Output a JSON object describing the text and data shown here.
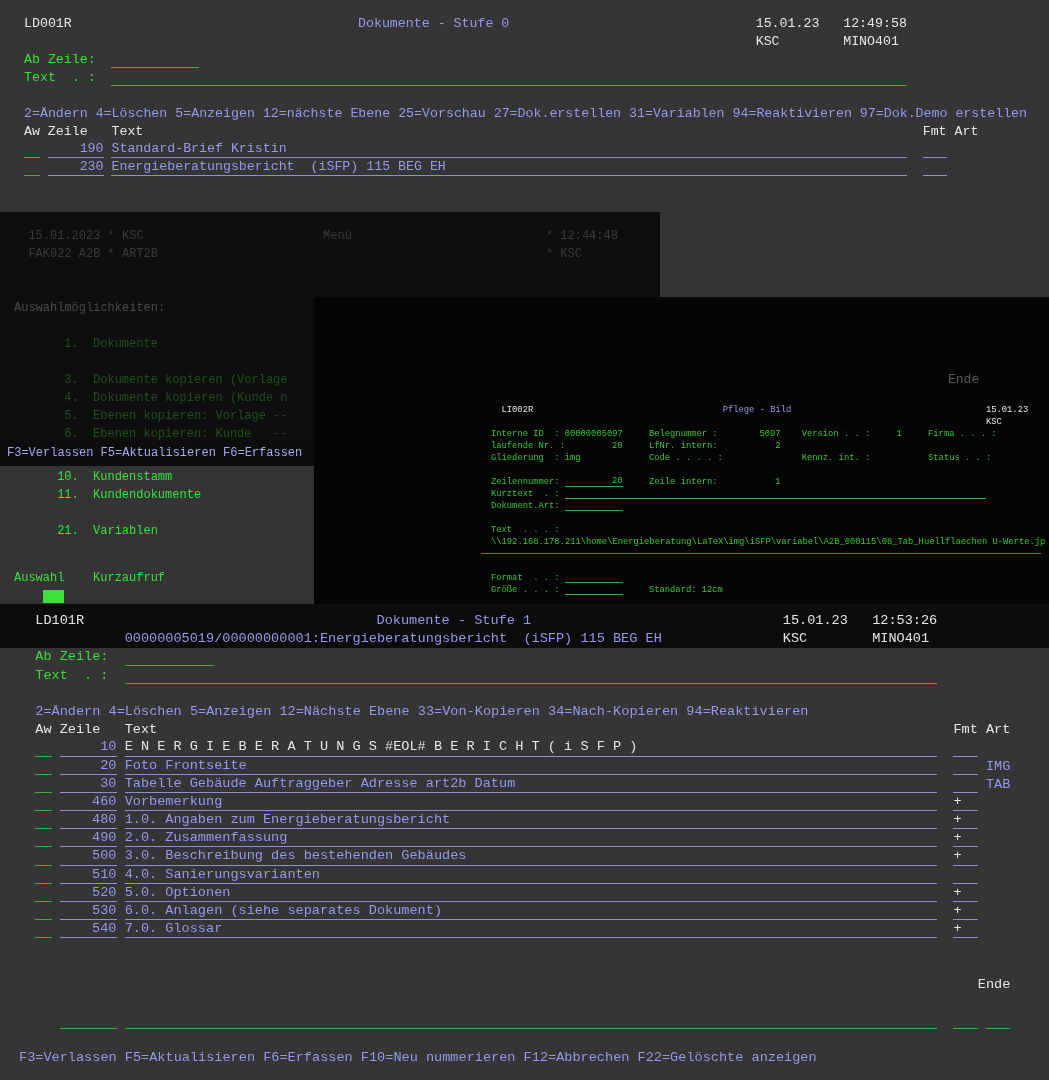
{
  "top_screen": {
    "program": "LD001R",
    "title": "Dokumente - Stufe 0",
    "date": "15.01.23",
    "time": "12:49:58",
    "user": "KSC",
    "device": "MINO401",
    "filters": [
      {
        "label": "Ab Zeile:"
      },
      {
        "label": "Text  . :"
      }
    ],
    "options": "2=Ändern 4=Löschen 5=Anzeigen 12=nächste Ebene 25=Vorschau 27=Dok.erstellen 31=Variablen 94=Reaktivieren 97=Dok.Demo erstellen",
    "columns": [
      "Aw",
      "Zeile",
      "Text",
      "Fmt",
      "Art"
    ],
    "rows": [
      {
        "line": "190",
        "text": "Standard-Brief Kristin"
      },
      {
        "line": "230",
        "text": "Energieberatungsbericht  (iSFP) 115 BEG EH"
      }
    ]
  },
  "menu_screen": {
    "date_user": "15.01.2023 * KSC",
    "title": "Menü",
    "time": "* 12:44:48",
    "session": "FAK022 A2B * ART2B",
    "user": "* KSC",
    "heading": "Auswahlmöglichkeiten:",
    "item_groups": [
      {
        "dimmed": true,
        "items": [
          {
            "number": "1.",
            "label": "Dokumente"
          }
        ]
      },
      {
        "dimmed": true,
        "items": [
          {
            "number": "3.",
            "label": "Dokumente kopieren (Vorlage"
          },
          {
            "number": "4.",
            "label": "Dokumente kopieren (Kunde n"
          },
          {
            "number": "5.",
            "label": "Ebenen kopieren: Vorlage --"
          },
          {
            "number": "6.",
            "label": "Ebenen kopieren: Kunde   --"
          }
        ]
      },
      {
        "dimmed": false,
        "items": [
          {
            "number": "10.",
            "label": "Kundenstamm"
          },
          {
            "number": "11.",
            "label": "Kundendokumente"
          }
        ]
      },
      {
        "dimmed": false,
        "items": [
          {
            "number": "21.",
            "label": "Variablen"
          }
        ]
      }
    ],
    "selection_label": "Auswahl",
    "shortcut_label": "Kurzaufruf"
  },
  "function_strip": {
    "keys": "F3=Verlassen F5=Aktualisieren F6=Erfassen"
  },
  "detail_window": {
    "end_label": "Ende",
    "program": "LI002R",
    "title": "Pflege - Bild",
    "date": "15.01.23",
    "user": "KSC",
    "sections": [
      [
        [
          {
            "label": "Interne ID  :",
            "value": "00000005097",
            "kind": "number"
          },
          {
            "label": "Belegnummer :",
            "value": "5097",
            "kind": "number"
          },
          {
            "label": "Version . . :",
            "value": "1",
            "kind": "number"
          },
          {
            "label": "Firma . . . :",
            "kind": "label"
          }
        ],
        [
          {
            "label": "laufende Nr. :",
            "value": "20",
            "kind": "number"
          },
          {
            "label": "LfNr. intern:",
            "value": "2",
            "kind": "number"
          }
        ],
        [
          {
            "label": "Gliederung  :",
            "value": "img",
            "kind": "text"
          },
          {
            "label": "Code . . . . :",
            "kind": "label"
          },
          {
            "label": "Kennz. int. :",
            "kind": "label"
          },
          {
            "label": "Status . . :",
            "kind": "label"
          }
        ]
      ],
      [
        [
          {
            "label": "Zeilennummer:",
            "value": "20",
            "kind": "field"
          },
          {
            "label": "Zeile intern:",
            "value": "1",
            "kind": "number"
          }
        ],
        [
          {
            "label": "Kurztext  . :",
            "kind": "long_field"
          }
        ],
        [
          {
            "label": "Dokument.Art:",
            "kind": "field"
          }
        ]
      ],
      [
        [
          {
            "label": "Text  . . . :",
            "kind": "label"
          }
        ],
        [
          {
            "value": "\\\\192.168.178.211\\home\\Energieberatung\\LaTeX\\img\\iSFP\\variabel\\A2B_000115\\08_Tab_Huellflaechen U-Werte.jp",
            "kind": "path"
          }
        ]
      ],
      [
        [
          {
            "label": "Format  . . :",
            "kind": "field"
          }
        ],
        [
          {
            "label": "Größe . . . :",
            "kind": "field"
          },
          {
            "label": "Standard: 12cm",
            "kind": "label"
          }
        ]
      ]
    ]
  },
  "bottom_screen": {
    "program": "LD101R",
    "title": "Dokumente - Stufe 1",
    "date": "15.01.23",
    "time": "12:53:26",
    "document": "00000005019/00000000001:Energieberatungsbericht  (iSFP) 115 BEG EH",
    "user": "KSC",
    "device": "MINO401",
    "filters": [
      {
        "label": "Ab Zeile:"
      },
      {
        "label": "Text  . :"
      }
    ],
    "options": "2=Ändern 4=Löschen 5=Anzeigen 12=Nächste Ebene 33=Von-Kopieren 34=Nach-Kopieren 94=Reaktivieren",
    "columns": [
      "Aw",
      "Zeile",
      "Text",
      "Fmt",
      "Art"
    ],
    "rows": [
      {
        "line": "10",
        "text": "E N E R G I E B E R A T U N G S #EOL# B E R I C H T ( i S F P )",
        "kind": "heading"
      },
      {
        "line": "20",
        "text": "Foto Frontseite",
        "art": "IMG",
        "kind": "entry"
      },
      {
        "line": "30",
        "text": "Tabelle Gebäude Auftraggeber Adresse art2b Datum",
        "art": "TAB",
        "kind": "entry"
      },
      {
        "line": "460",
        "text": "Vorbemerkung",
        "fmt": "+",
        "kind": "entry"
      },
      {
        "line": "480",
        "text": "1.0. Angaben zum Energieberatungsbericht",
        "fmt": "+",
        "kind": "entry"
      },
      {
        "line": "490",
        "text": "2.0. Zusammenfassung",
        "fmt": "+",
        "kind": "entry"
      },
      {
        "line": "500",
        "text": "3.0. Beschreibung des bestehenden Gebäudes",
        "fmt": "+",
        "kind": "entry"
      },
      {
        "line": "510",
        "text": "4.0. Sanierungsvarianten",
        "kind": "entry"
      },
      {
        "line": "520",
        "text": "5.0. Optionen",
        "fmt": "+",
        "kind": "entry"
      },
      {
        "line": "530",
        "text": "6.0. Anlagen (siehe separates Dokument)",
        "fmt": "+",
        "kind": "entry"
      },
      {
        "line": "540",
        "text": "7.0. Glossar",
        "fmt": "+",
        "kind": "entry"
      }
    ],
    "end_label": "Ende",
    "function_keys": "F3=Verlassen F5=Aktualisieren F6=Erfassen F10=Neu nummerieren F12=Abbrechen F22=Gelöschte anzeigen"
  }
}
